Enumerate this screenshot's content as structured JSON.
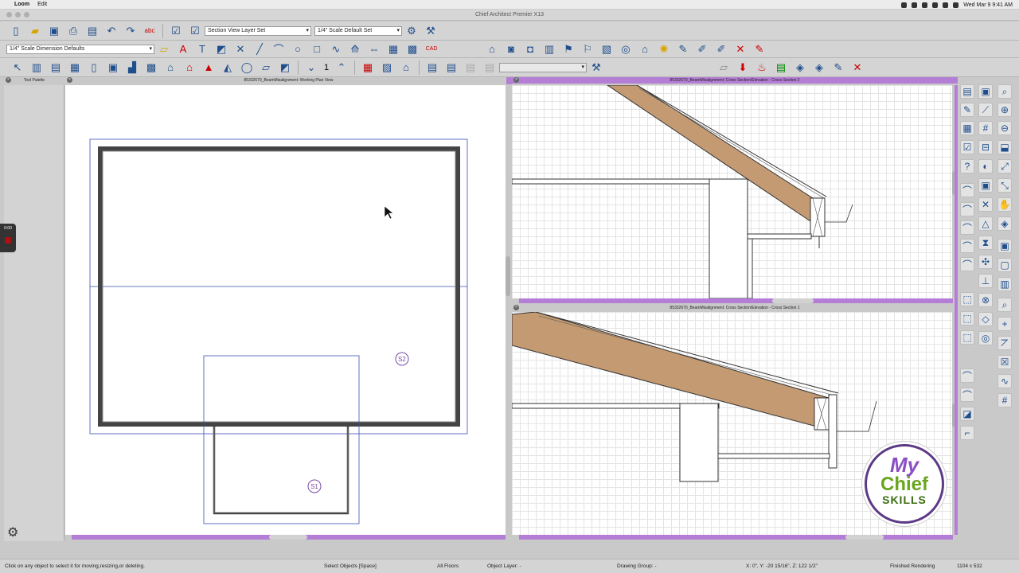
{
  "menubar": {
    "app_name": "Loom",
    "menu_edit": "Edit",
    "datetime": "Wed Mar 9  9:41 AM"
  },
  "window": {
    "title": "Chief Architect Premier X13"
  },
  "toolbar": {
    "layer_set": "Section View Layer Set",
    "default_set": "1/4\" Scale Default Set",
    "dimension_defaults": "1/4\" Scale Dimension Defaults",
    "floor_number": "1"
  },
  "panes": {
    "tool_palette": "Tool Palette",
    "plan_title": "85332670_BeamMisalignment:  Working Plan View",
    "cross2_title": "85332670_BeamMisalignment: Cross Section/Elevation - Cross Section 2",
    "cross1_title": "85332670_BeamMisalignment: Cross Section/Elevation - Cross Section 1"
  },
  "plan": {
    "marker_s2": "S2",
    "marker_s1": "S1"
  },
  "recorder": {
    "time": "0:00"
  },
  "status": {
    "hint": "Click on any object to select it for moving,resizing,or deleting.",
    "mode": "Select Objects [Space]",
    "floors": "All Floors",
    "object_layer": "Object Layer: -",
    "drawing_group": "Drawing Group: -",
    "coords": "X: 0\", Y: -20 15/16\", Z: 122 1/2\"",
    "render_state": "Finished Rendering",
    "size": "1104 x 532"
  },
  "logo": {
    "line1": "My",
    "line2": "Chief",
    "line3": "SKILLS"
  },
  "colors": {
    "accent": "#b57ed6",
    "rafter": "#c49a72",
    "plan_line": "#3a4fb5"
  }
}
